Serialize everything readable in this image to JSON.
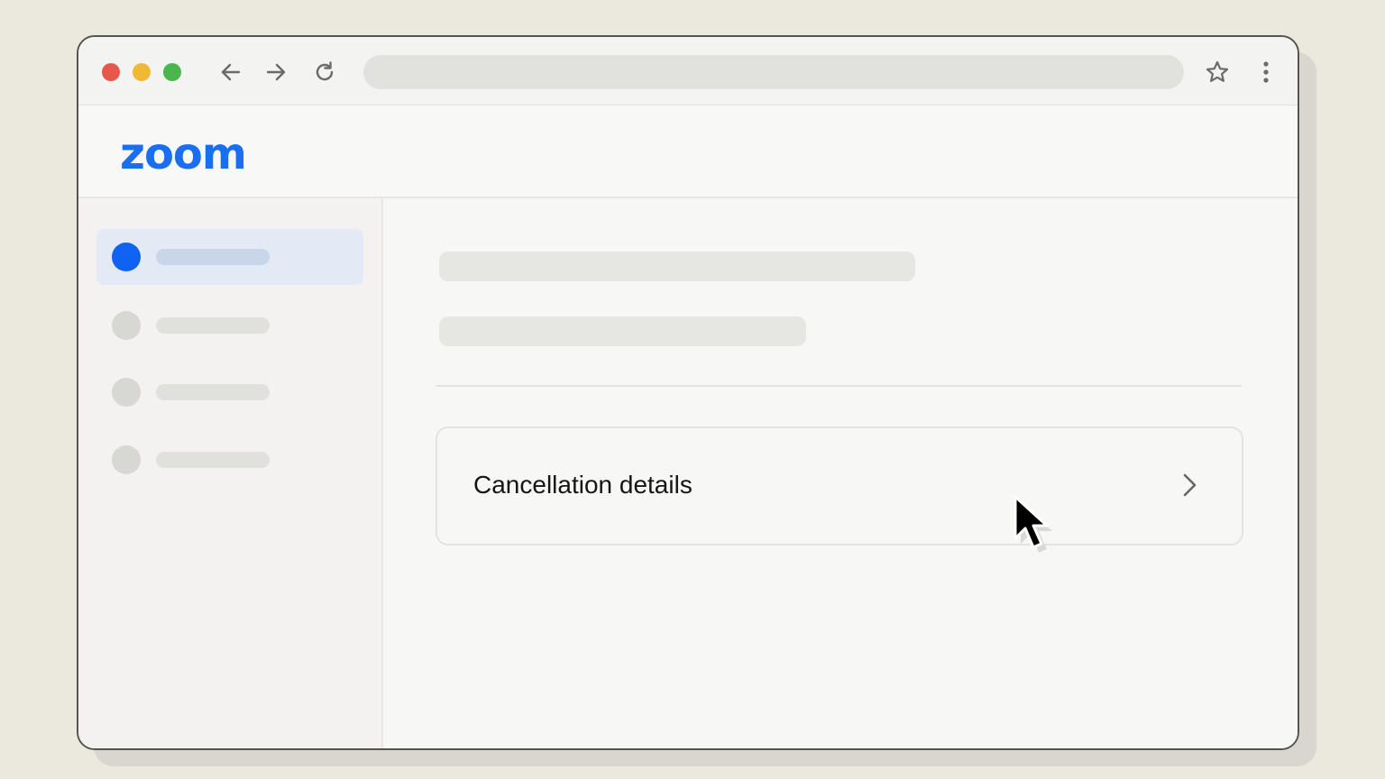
{
  "browser": {
    "traffic_lights": {
      "red": "#e8574a",
      "yellow": "#f0b935",
      "green": "#4bb64d"
    },
    "icons": [
      "back-arrow-icon",
      "forward-arrow-icon",
      "reload-icon",
      "star-icon",
      "kebab-menu-icon"
    ],
    "address_bar_value": ""
  },
  "header": {
    "logo_text": "zoom",
    "brand_color": "#1a6ef0"
  },
  "sidebar": {
    "items": [
      {
        "active": true,
        "accent": "#0f62f2"
      },
      {
        "active": false
      },
      {
        "active": false
      },
      {
        "active": false
      }
    ]
  },
  "main": {
    "card": {
      "label": "Cancellation details",
      "icon": "chevron-right-icon"
    }
  },
  "cursor": {
    "icon": "mouse-pointer-icon"
  }
}
